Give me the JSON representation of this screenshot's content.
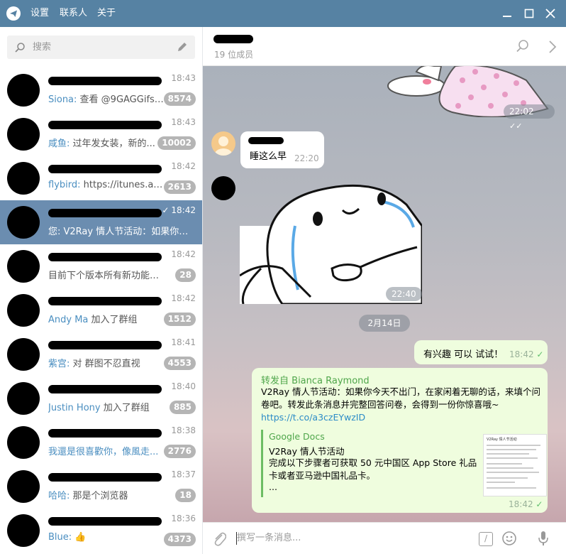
{
  "titlebar": {
    "menu": [
      "设置",
      "联系人",
      "关于"
    ],
    "controls": [
      "minimize-icon",
      "maximize-icon",
      "close-icon"
    ],
    "color": "#5682a3"
  },
  "search": {
    "placeholder": "搜索"
  },
  "chats": [
    {
      "time": "18:43",
      "sender": "Siona:",
      "preview": " 查看 @9GAGGifs 的...",
      "badge": "8574"
    },
    {
      "time": "18:43",
      "sender": "咸鱼:",
      "preview": " 过年发女装，新的...",
      "badge": "10002"
    },
    {
      "time": "18:42",
      "sender": "flybird:",
      "preview": " https://itunes.app...",
      "badge": "2613"
    },
    {
      "time": "18:42",
      "sender": "",
      "preview": "您: V2Ray 情人节活动：如果你今...",
      "badge": "",
      "active": true
    },
    {
      "time": "18:42",
      "sender": "",
      "preview": "目前下个版本所有新功能都在...",
      "badge": "28"
    },
    {
      "time": "18:42",
      "sender": "Andy Ma",
      "preview": " 加入了群组",
      "badge": "1512"
    },
    {
      "time": "18:41",
      "sender": "紫宫:",
      "preview": " 对 群图不忍直视",
      "badge": "4553"
    },
    {
      "time": "18:40",
      "sender": "Justin Hony",
      "preview": " 加入了群组",
      "badge": "885"
    },
    {
      "time": "18:38",
      "sender": "我還是很喜歡你，像風走...",
      "preview": "",
      "badge": "2776"
    },
    {
      "time": "18:37",
      "sender": "哈哈:",
      "preview": " 那是个浏览器",
      "badge": "18"
    },
    {
      "time": "18:36",
      "sender": "Blue:",
      "preview": " 👍",
      "badge": "4373"
    }
  ],
  "header": {
    "members": "19 位成员"
  },
  "messages": {
    "sticker_top_time": "22:02",
    "text_in": {
      "text": "睡这么早",
      "time": "22:20"
    },
    "sticker_time": "22:40",
    "date_chip": "2月14日",
    "out1": {
      "text": "有兴趣 可以 试试！",
      "time": "18:42"
    },
    "forward": {
      "prefix": "转发自",
      "from": "Bianca Raymond",
      "body": "V2Ray 情人节活动：如果你今天不出门，在家闲着无聊的话，来填个问卷吧。转发此条消息并完整回答问卷，会得到一份你惊喜哦~",
      "link": "https://t.co/a3czEYwzID",
      "preview_site": "Google Docs",
      "preview_title": "V2Ray 情人节活动",
      "preview_desc": "完成以下步骤者可获取 50 元中国区 App Store 礼品卡或者亚马逊中国礼品卡。",
      "preview_more": "...",
      "thumb_title": "V2Ray 情人节活动",
      "time": "18:42"
    }
  },
  "composer": {
    "placeholder": "撰写一条消息..."
  }
}
